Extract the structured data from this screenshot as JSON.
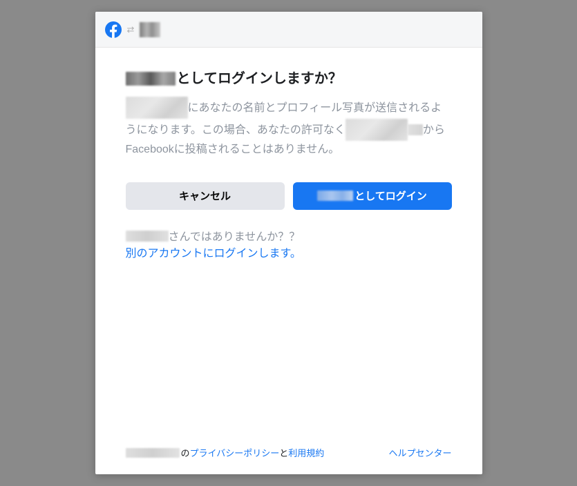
{
  "header": {
    "logo_name": "facebook-logo"
  },
  "dialog": {
    "title_suffix": "としてログインしますか？",
    "description_part1": "にあなたの名前とプロフィール写真が送信されるようになります。この場合、あなたの許可なく",
    "description_part2": "からFacebookに投稿されることはありません。"
  },
  "buttons": {
    "cancel": "キャンセル",
    "login_suffix": "としてログイン"
  },
  "not_you": {
    "suffix": "さんではありませんか？？",
    "switch_link": "別のアカウントにログインします。"
  },
  "footer": {
    "possessive": "の",
    "privacy": "プライバシーポリシー",
    "and": "と",
    "terms": "利用規約",
    "help": "ヘルプセンター"
  }
}
